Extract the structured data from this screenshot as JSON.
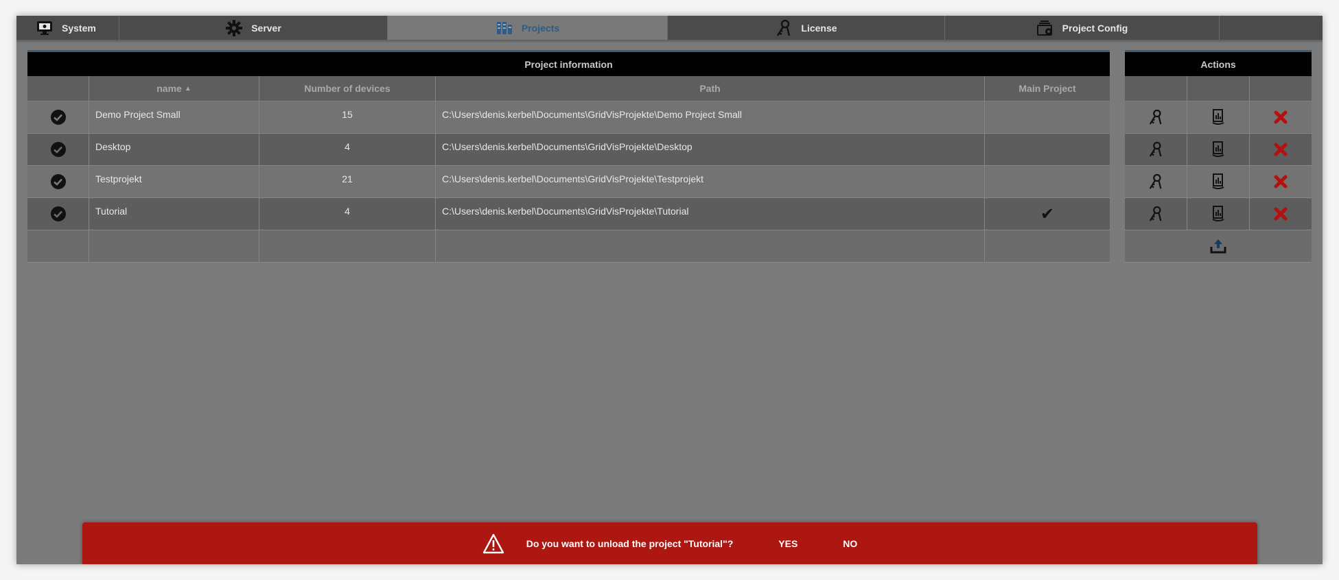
{
  "nav": {
    "items": [
      {
        "label": "System",
        "icon": "monitor-icon"
      },
      {
        "label": "Server",
        "icon": "gear-icon"
      },
      {
        "label": "Projects",
        "icon": "projects-icon",
        "active": true
      },
      {
        "label": "License",
        "icon": "license-key-icon"
      },
      {
        "label": "Project Config",
        "icon": "project-config-icon"
      }
    ],
    "active_color": "#2a5d8a"
  },
  "project_table": {
    "title": "Project information",
    "columns": [
      "",
      "name",
      "Number of devices",
      "Path",
      "Main Project"
    ],
    "sort_indicator": "▲",
    "rows": [
      {
        "name": "Demo Project Small",
        "devices": "15",
        "path": "C:\\Users\\denis.kerbel\\Documents\\GridVisProjekte\\Demo Project Small",
        "main": ""
      },
      {
        "name": "Desktop",
        "devices": "4",
        "path": "C:\\Users\\denis.kerbel\\Documents\\GridVisProjekte\\Desktop",
        "main": ""
      },
      {
        "name": "Testprojekt",
        "devices": "21",
        "path": "C:\\Users\\denis.kerbel\\Documents\\GridVisProjekte\\Testprojekt",
        "main": ""
      },
      {
        "name": "Tutorial",
        "devices": "4",
        "path": "C:\\Users\\denis.kerbel\\Documents\\GridVisProjekte\\Tutorial",
        "main": "✔"
      }
    ]
  },
  "actions_table": {
    "title": "Actions",
    "row_icons": [
      "license-key-icon",
      "project-config-icon",
      "delete-icon"
    ],
    "footer_icon": "upload-icon"
  },
  "dialog": {
    "message": "Do you want to unload the project \"Tutorial\"?",
    "yes_label": "YES",
    "no_label": "NO",
    "background": "#ac1712",
    "icon": "warning-icon"
  }
}
